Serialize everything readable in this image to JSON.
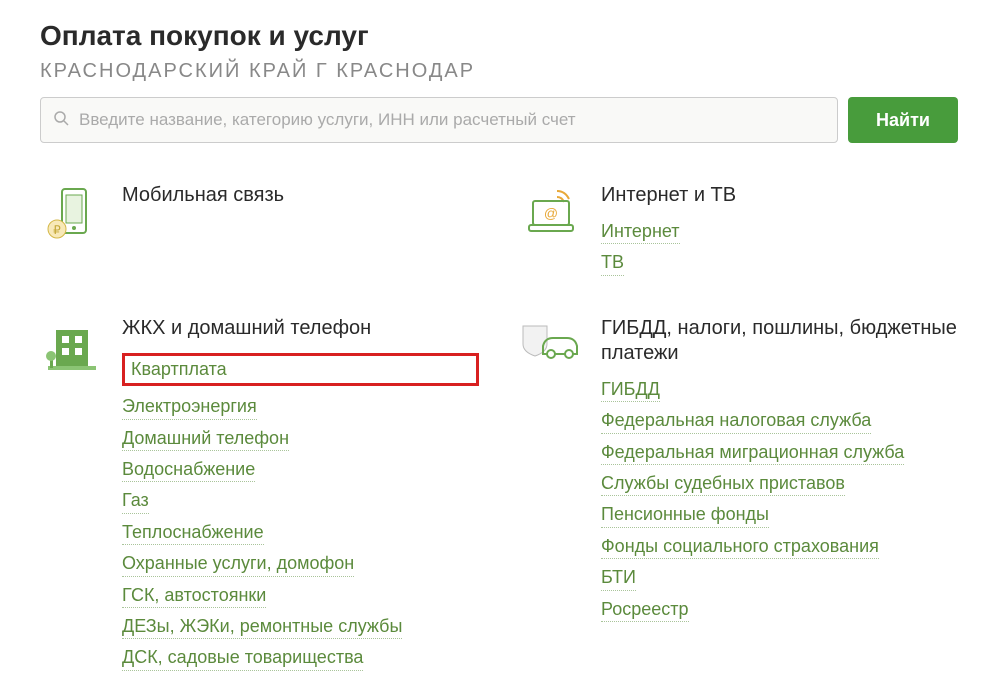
{
  "header": {
    "title": "Оплата покупок и услуг",
    "region": "КРАСНОДАРСКИЙ КРАЙ Г КРАСНОДАР"
  },
  "search": {
    "placeholder": "Введите название, категорию услуги, ИНН или расчетный счет",
    "button": "Найти"
  },
  "categories": [
    {
      "id": "mobile",
      "title": "Мобильная связь",
      "links": []
    },
    {
      "id": "internet",
      "title": "Интернет и ТВ",
      "links": [
        "Интернет",
        "ТВ"
      ]
    },
    {
      "id": "zhkh",
      "title": "ЖКХ и домашний телефон",
      "highlighted": "Квартплата",
      "links": [
        "Электроэнергия",
        "Домашний телефон",
        "Водоснабжение",
        "Газ",
        "Теплоснабжение",
        "Охранные услуги, домофон",
        "ГСК, автостоянки",
        "ДЕЗы, ЖЭКи, ремонтные службы",
        "ДСК, садовые товарищества"
      ]
    },
    {
      "id": "gibdd",
      "title": "ГИБДД, налоги, пошлины, бюджетные платежи",
      "links": [
        "ГИБДД",
        "Федеральная налоговая служба",
        "Федеральная миграционная служба",
        "Службы судебных приставов",
        "Пенсионные фонды",
        "Фонды социального страхования",
        "БТИ",
        "Росреестр"
      ]
    }
  ]
}
